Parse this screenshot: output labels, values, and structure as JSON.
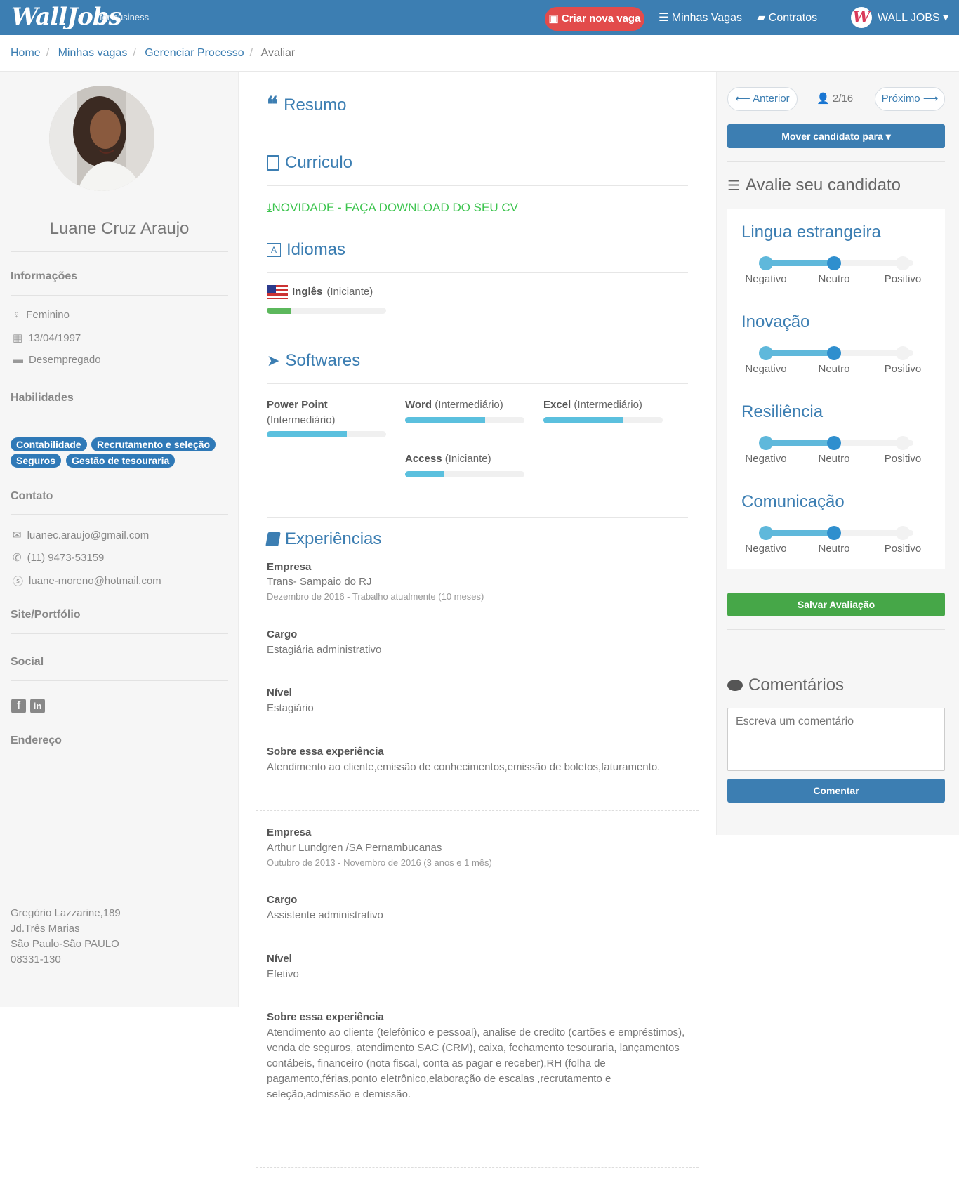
{
  "header": {
    "logo": "WallJobs",
    "logo_sub": "for business",
    "new_job": "Criar nova vaga",
    "my_jobs": "Minhas Vagas",
    "contracts": "Contratos",
    "user": "WALL JOBS",
    "brand_color": "#3c7eb2"
  },
  "breadcrumb": [
    "Home",
    "Minhas vagas",
    "Gerenciar Processo",
    "Avaliar"
  ],
  "candidate": {
    "name": "Luane Cruz Araujo",
    "info_title": "Informações",
    "gender": "Feminino",
    "birth": "13/04/1997",
    "status": "Desempregado",
    "skills_title": "Habilidades",
    "skills": [
      "Contabilidade",
      "Recrutamento e seleção",
      "Seguros",
      "Gestão de tesouraria"
    ],
    "contact_title": "Contato",
    "email": "luanec.araujo@gmail.com",
    "phone": "(11) 9473-53159",
    "skype": "luane-moreno@hotmail.com",
    "site_title": "Site/Portfólio",
    "social_title": "Social",
    "address_title": "Endereço",
    "address": [
      "Gregório Lazzarine,189",
      "Jd.Três Marias",
      "São Paulo-São PAULO",
      "08331-130"
    ]
  },
  "main": {
    "summary_title": "Resumo",
    "cv_title": "Curriculo",
    "cv_download": "NOVIDADE - FAÇA DOWNLOAD DO SEU CV",
    "languages_title": "Idiomas",
    "languages": [
      {
        "name": "Inglês",
        "level": "(Iniciante)",
        "progress": 0.2
      }
    ],
    "software_title": "Softwares",
    "software": [
      {
        "name": "Power Point",
        "level": "(Intermediário)",
        "progress": 0.67
      },
      {
        "name": "Word",
        "level": "(Intermediário)",
        "progress": 0.67
      },
      {
        "name": "Excel",
        "level": "(Intermediário)",
        "progress": 0.67
      },
      {
        "name": "Access",
        "level": "(Iniciante)",
        "progress": 0.33
      }
    ],
    "experience_title": "Experiências",
    "labels": {
      "company": "Empresa",
      "role": "Cargo",
      "level": "Nível",
      "about": "Sobre essa experiência"
    },
    "experiences": [
      {
        "company": "Trans- Sampaio do RJ",
        "period": "Dezembro de 2016 - Trabalho atualmente (10 meses)",
        "role": "Estagiária administrativo",
        "level": "Estagiário",
        "about": "Atendimento ao cliente,emissão de conhecimentos,emissão de boletos,faturamento."
      },
      {
        "company": "Arthur Lundgren /SA Pernambucanas",
        "period": "Outubro de 2013 - Novembro de 2016 (3 anos e 1 mês)",
        "role": "Assistente administrativo",
        "level": "Efetivo",
        "about": "Atendimento ao cliente (telefônico e pessoal), analise de credito (cartões e empréstimos), venda de seguros, atendimento SAC (CRM), caixa, fechamento tesouraria, lançamentos contábeis, financeiro (nota fiscal, conta as pagar e receber),RH (folha de pagamento,férias,ponto eletrônico,elaboração de escalas ,recrutamento e seleção,admissão e demissão."
      }
    ]
  },
  "sidebar": {
    "prev": "Anterior",
    "counter": "2/16",
    "next": "Próximo",
    "move": "Mover candidato para",
    "eval_title": "Avalie seu candidato",
    "scale": [
      "Negativo",
      "Neutro",
      "Positivo"
    ],
    "criteria": [
      {
        "name": "Lingua estrangeira",
        "value": "Neutro"
      },
      {
        "name": "Inovação",
        "value": "Neutro"
      },
      {
        "name": "Resiliência",
        "value": "Neutro"
      },
      {
        "name": "Comunicação",
        "value": "Neutro"
      }
    ],
    "save": "Salvar Avaliação",
    "comments_title": "Comentários",
    "comment_placeholder": "Escreva um comentário",
    "comment_button": "Comentar"
  }
}
